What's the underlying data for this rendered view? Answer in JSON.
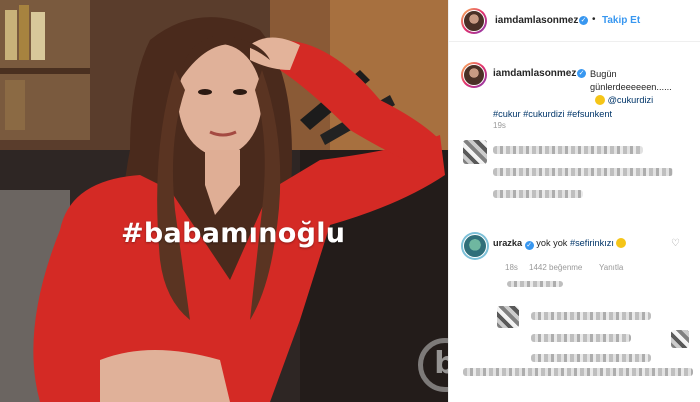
{
  "post": {
    "image_caption": "#babamınoğlu"
  },
  "header": {
    "username": "iamdamlasonmez",
    "separator": "•",
    "follow_label": "Takip Et"
  },
  "caption": {
    "username": "iamdamlasonmez",
    "text_1": "Bugün günlerdeeeeeen......",
    "mention": "@cukurdizi",
    "hashtags": "#cukur #cukurdizi #efsunkent",
    "time": "19s"
  },
  "comment": {
    "username": "urazka",
    "text": "yok yok",
    "hashtag": "#sefirinkızı",
    "time": "18s",
    "likes": "1442 beğenme",
    "reply_label": "Yanıtla"
  },
  "watermark": "b",
  "colors": {
    "link": "#3897f0",
    "hashtag": "#003569",
    "dress": "#d42a25"
  }
}
